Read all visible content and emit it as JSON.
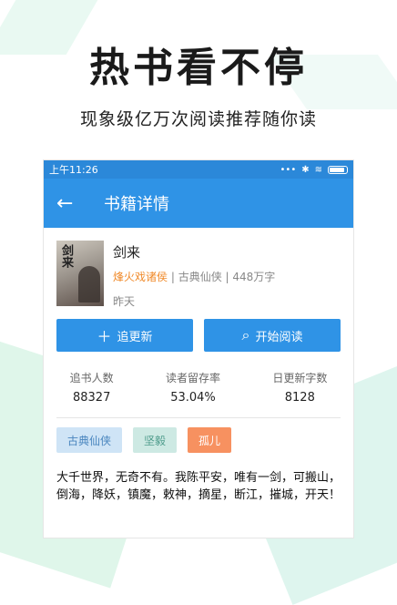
{
  "promo": {
    "headline": "热书看不停",
    "subline": "现象级亿万次阅读推荐随你读"
  },
  "status_bar": {
    "time": "上午11:26"
  },
  "app_bar": {
    "title": "书籍详情",
    "back_icon": "arrow-left"
  },
  "book": {
    "title": "剑来",
    "author": "烽火戏诸侯",
    "category": "古典仙侠",
    "word_count": "448万字",
    "updated": "昨天",
    "cover_text": "剑来"
  },
  "actions": {
    "follow_label": "追更新",
    "read_label": "开始阅读"
  },
  "stats": [
    {
      "label": "追书人数",
      "value": "88327"
    },
    {
      "label": "读者留存率",
      "value": "53.04%"
    },
    {
      "label": "日更新字数",
      "value": "8128"
    }
  ],
  "tags": [
    "古典仙侠",
    "坚毅",
    "孤儿"
  ],
  "description": "大千世界，无奇不有。我陈平安，唯有一剑，可搬山，倒海，降妖，镇魔，敕神，摘星，断江，摧城，开天！",
  "colors": {
    "primary": "#2f93e6",
    "author": "#f08a2a",
    "tag_orange": "#f79160"
  }
}
